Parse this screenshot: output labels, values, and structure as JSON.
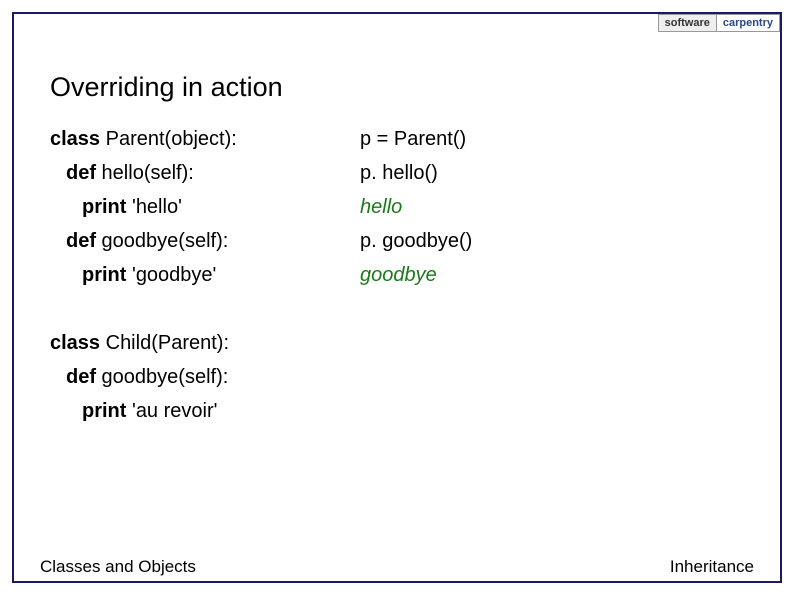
{
  "logo": {
    "word1": "software",
    "word2": "carpentry",
    "subtitle": ""
  },
  "title": "Overriding in action",
  "leftCode": {
    "l1_kw": "class",
    "l1_rest": " Parent(object):",
    "l2_kw": "def",
    "l2_rest": " hello(self):",
    "l3_kw": "print",
    "l3_rest": " 'hello'",
    "l4_kw": "def",
    "l4_rest": " goodbye(self):",
    "l5_kw": "print",
    "l5_rest": " 'goodbye'",
    "l6_kw": "class",
    "l6_rest": " Child(Parent):",
    "l7_kw": "def",
    "l7_rest": " goodbye(self):",
    "l8_kw": "print",
    "l8_rest": " 'au revoir'"
  },
  "rightCode": {
    "r1": "p = Parent()",
    "r2": "p. hello()",
    "r3": "hello",
    "r4": "p. goodbye()",
    "r5": "goodbye"
  },
  "footer": {
    "left": "Classes and Objects",
    "right": "Inheritance"
  }
}
